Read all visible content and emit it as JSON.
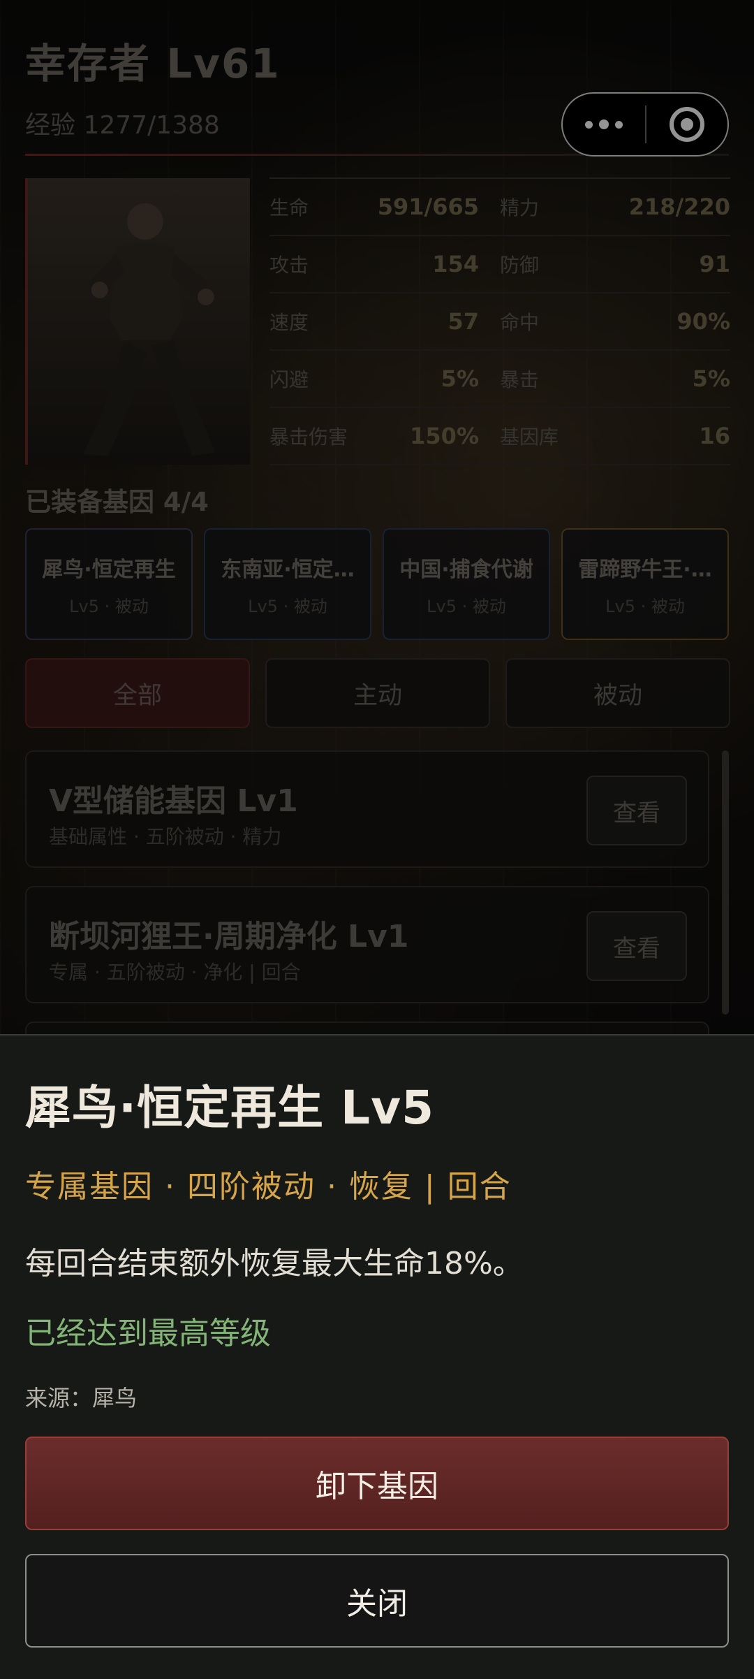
{
  "header": {
    "title": "幸存者 Lv61",
    "exp": "经验 1277/1388"
  },
  "stats": [
    [
      {
        "label": "生命",
        "value": "591/665"
      },
      {
        "label": "精力",
        "value": "218/220"
      }
    ],
    [
      {
        "label": "攻击",
        "value": "154"
      },
      {
        "label": "防御",
        "value": "91"
      }
    ],
    [
      {
        "label": "速度",
        "value": "57"
      },
      {
        "label": "命中",
        "value": "90%"
      }
    ],
    [
      {
        "label": "闪避",
        "value": "5%"
      },
      {
        "label": "暴击",
        "value": "5%"
      }
    ],
    [
      {
        "label": "暴击伤害",
        "value": "150%"
      },
      {
        "label": "基因库",
        "value": "16"
      }
    ]
  ],
  "equipped": {
    "title": "已装备基因 4/4",
    "slots": [
      {
        "name": "犀鸟·恒定再生",
        "sub": "Lv5 · 被动"
      },
      {
        "name": "东南亚·恒定…",
        "sub": "Lv5 · 被动"
      },
      {
        "name": "中国·捕食代谢",
        "sub": "Lv5 · 被动"
      },
      {
        "name": "雷蹄野牛王·…",
        "sub": "Lv5 · 被动"
      }
    ]
  },
  "tabs": [
    "全部",
    "主动",
    "被动"
  ],
  "list": [
    {
      "name": "V型储能基因 Lv1",
      "sub": "基础属性 · 五阶被动 · 精力",
      "button": "查看"
    },
    {
      "name": "断坝河狸王·周期净化 Lv1",
      "sub": "专属 · 五阶被动 · 净化 | 回合",
      "button": "查看"
    }
  ],
  "sheet": {
    "title": "犀鸟·恒定再生 Lv5",
    "tags": "专属基因 · 四阶被动 · 恢复 | 回合",
    "description": "每回合结束额外恢复最大生命18%。",
    "status": "已经达到最高等级",
    "source": "来源：犀鸟",
    "unequip_label": "卸下基因",
    "close_label": "关闭"
  },
  "colors": {
    "accent_red": "#6a2d2b",
    "tag_gold": "#d6a54a",
    "status_green": "#83b577"
  }
}
